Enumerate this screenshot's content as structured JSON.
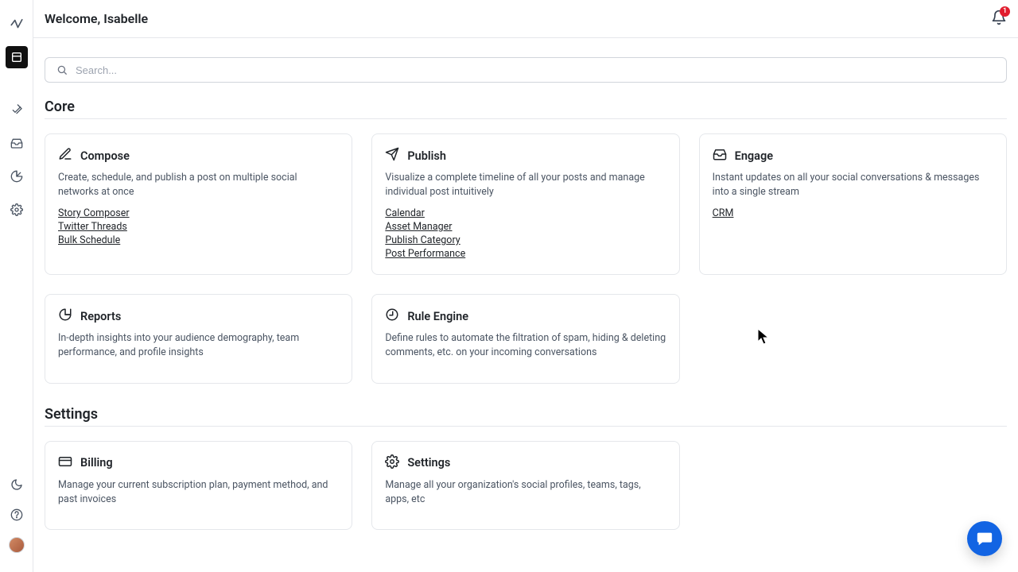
{
  "header": {
    "welcome": "Welcome, Isabelle",
    "notification_count": "1"
  },
  "search": {
    "placeholder": "Search..."
  },
  "sections": {
    "core": {
      "heading": "Core",
      "cards": {
        "compose": {
          "title": "Compose",
          "desc": "Create, schedule, and publish a post on multiple social networks at once",
          "links": [
            "Story Composer",
            "Twitter Threads",
            "Bulk Schedule"
          ]
        },
        "publish": {
          "title": "Publish",
          "desc": "Visualize a complete timeline of all your posts and manage individual post intuitively",
          "links": [
            "Calendar",
            "Asset Manager",
            "Publish Category",
            "Post Performance"
          ]
        },
        "engage": {
          "title": "Engage",
          "desc": "Instant updates on all your social conversations & messages into a single stream",
          "links": [
            "CRM"
          ]
        },
        "reports": {
          "title": "Reports",
          "desc": "In-depth insights into your audience demography, team performance, and profile insights"
        },
        "rule_engine": {
          "title": "Rule Engine",
          "desc": "Define rules to automate the filtration of spam, hiding & deleting comments, etc. on your incoming conversations"
        }
      }
    },
    "settings": {
      "heading": "Settings",
      "cards": {
        "billing": {
          "title": "Billing",
          "desc": "Manage your current subscription plan, payment method, and past invoices"
        },
        "settings": {
          "title": "Settings",
          "desc": "Manage all your organization's social profiles, teams, tags, apps, etc"
        }
      }
    }
  }
}
